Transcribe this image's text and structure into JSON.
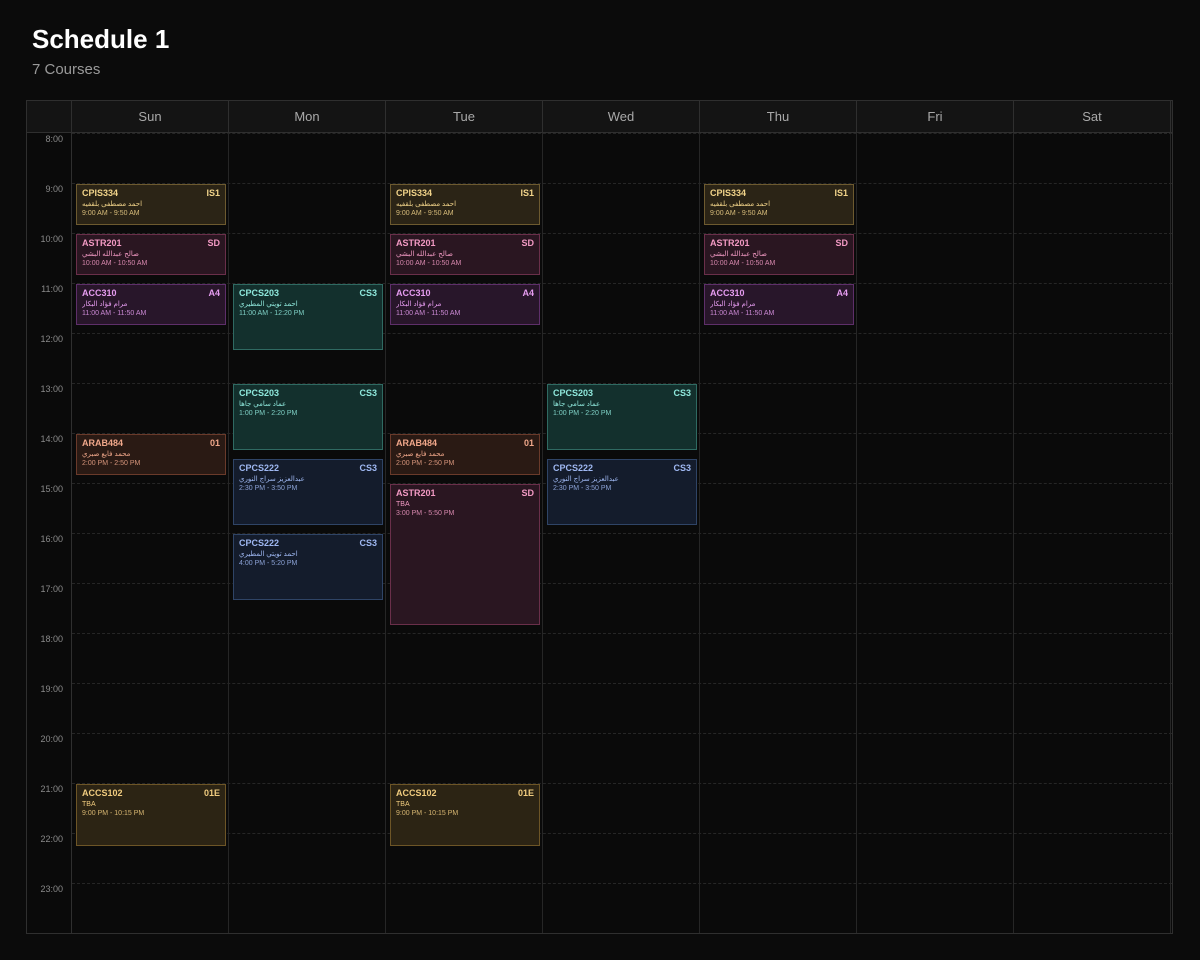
{
  "schedule": {
    "title": "Schedule 1",
    "subtitle": "7 Courses"
  },
  "days": [
    "Sun",
    "Mon",
    "Tue",
    "Wed",
    "Thu",
    "Fri",
    "Sat"
  ],
  "hours": [
    "8:00",
    "9:00",
    "10:00",
    "11:00",
    "12:00",
    "13:00",
    "14:00",
    "15:00",
    "16:00",
    "17:00",
    "18:00",
    "19:00",
    "20:00",
    "21:00",
    "22:00",
    "23:00"
  ],
  "events": [
    {
      "day": 0,
      "start": 9,
      "end": 9.8333,
      "code": "CPIS334",
      "section": "IS1",
      "instructor": "احمد مصطفى بلقفيه",
      "time": "9:00 AM - 9:50 AM",
      "color": "gold"
    },
    {
      "day": 0,
      "start": 10,
      "end": 10.8333,
      "code": "ASTR201",
      "section": "SD",
      "instructor": "صالح عبدالله البشي",
      "time": "10:00 AM - 10:50 AM",
      "color": "astr"
    },
    {
      "day": 0,
      "start": 11,
      "end": 11.8333,
      "code": "ACC310",
      "section": "A4",
      "instructor": "مرام فؤاد البكار",
      "time": "11:00 AM - 11:50 AM",
      "color": "acc"
    },
    {
      "day": 0,
      "start": 14,
      "end": 14.8333,
      "code": "ARAB484",
      "section": "01",
      "instructor": "محمد فايع صبري",
      "time": "2:00 PM - 2:50 PM",
      "color": "arab"
    },
    {
      "day": 0,
      "start": 21,
      "end": 22.25,
      "code": "ACCS102",
      "section": "01E",
      "instructor": "TBA",
      "time": "9:00 PM - 10:15 PM",
      "color": "accs"
    },
    {
      "day": 1,
      "start": 11,
      "end": 12.3333,
      "code": "CPCS203",
      "section": "CS3",
      "instructor": "احمد تويتي المطيري",
      "time": "11:00 AM - 12:20 PM",
      "color": "teal"
    },
    {
      "day": 1,
      "start": 13,
      "end": 14.3333,
      "code": "CPCS203",
      "section": "CS3",
      "instructor": "عماد سامي جاها",
      "time": "1:00 PM - 2:20 PM",
      "color": "teal"
    },
    {
      "day": 1,
      "start": 14.5,
      "end": 15.8333,
      "code": "CPCS222",
      "section": "CS3",
      "instructor": "عبدالعزيز سراج النوري",
      "time": "2:30 PM - 3:50 PM",
      "color": "navy"
    },
    {
      "day": 1,
      "start": 16,
      "end": 17.3333,
      "code": "CPCS222",
      "section": "CS3",
      "instructor": "احمد تويتي المطيري",
      "time": "4:00 PM - 5:20 PM",
      "color": "navy"
    },
    {
      "day": 2,
      "start": 9,
      "end": 9.8333,
      "code": "CPIS334",
      "section": "IS1",
      "instructor": "احمد مصطفى بلقفيه",
      "time": "9:00 AM - 9:50 AM",
      "color": "gold"
    },
    {
      "day": 2,
      "start": 10,
      "end": 10.8333,
      "code": "ASTR201",
      "section": "SD",
      "instructor": "صالح عبدالله البشي",
      "time": "10:00 AM - 10:50 AM",
      "color": "astr"
    },
    {
      "day": 2,
      "start": 11,
      "end": 11.8333,
      "code": "ACC310",
      "section": "A4",
      "instructor": "مرام فؤاد البكار",
      "time": "11:00 AM - 11:50 AM",
      "color": "acc"
    },
    {
      "day": 2,
      "start": 14,
      "end": 14.8333,
      "code": "ARAB484",
      "section": "01",
      "instructor": "محمد فايع صبري",
      "time": "2:00 PM - 2:50 PM",
      "color": "arab"
    },
    {
      "day": 2,
      "start": 15,
      "end": 17.8333,
      "code": "ASTR201",
      "section": "SD",
      "instructor": "TBA",
      "time": "3:00 PM - 5:50 PM",
      "color": "astr"
    },
    {
      "day": 2,
      "start": 21,
      "end": 22.25,
      "code": "ACCS102",
      "section": "01E",
      "instructor": "TBA",
      "time": "9:00 PM - 10:15 PM",
      "color": "accs"
    },
    {
      "day": 3,
      "start": 13,
      "end": 14.3333,
      "code": "CPCS203",
      "section": "CS3",
      "instructor": "عماد سامي جاها",
      "time": "1:00 PM - 2:20 PM",
      "color": "teal"
    },
    {
      "day": 3,
      "start": 14.5,
      "end": 15.8333,
      "code": "CPCS222",
      "section": "CS3",
      "instructor": "عبدالعزيز سراج النوري",
      "time": "2:30 PM - 3:50 PM",
      "color": "navy"
    },
    {
      "day": 4,
      "start": 9,
      "end": 9.8333,
      "code": "CPIS334",
      "section": "IS1",
      "instructor": "احمد مصطفى بلقفيه",
      "time": "9:00 AM - 9:50 AM",
      "color": "gold"
    },
    {
      "day": 4,
      "start": 10,
      "end": 10.8333,
      "code": "ASTR201",
      "section": "SD",
      "instructor": "صالح عبدالله البشي",
      "time": "10:00 AM - 10:50 AM",
      "color": "astr"
    },
    {
      "day": 4,
      "start": 11,
      "end": 11.8333,
      "code": "ACC310",
      "section": "A4",
      "instructor": "مرام فؤاد البكار",
      "time": "11:00 AM - 11:50 AM",
      "color": "acc"
    }
  ]
}
